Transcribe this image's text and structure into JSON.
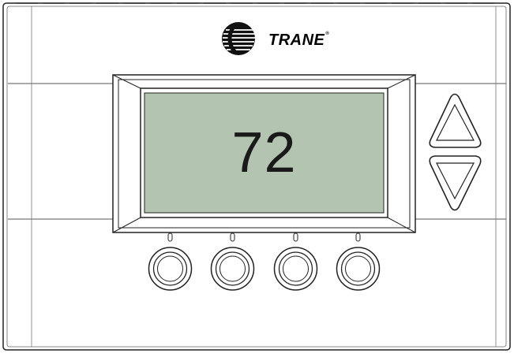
{
  "brand": {
    "name": "TRANE",
    "registered_mark": "®"
  },
  "display": {
    "temperature": "72"
  },
  "controls": {
    "up_button": {
      "icon": "up-triangle-icon"
    },
    "down_button": {
      "icon": "down-triangle-icon"
    },
    "soft_keys": [
      {
        "icon": "round-button-icon"
      },
      {
        "icon": "round-button-icon"
      },
      {
        "icon": "round-button-icon"
      },
      {
        "icon": "round-button-icon"
      }
    ]
  },
  "colors": {
    "body": "#ffffff",
    "outline": "#222222",
    "lcd": "#b3c5b1"
  }
}
